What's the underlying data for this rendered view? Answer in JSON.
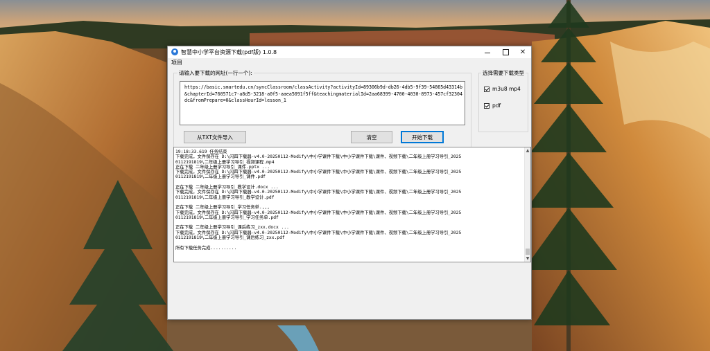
{
  "window": {
    "title": "智慧中小学平台资源下载(pdf版) 1.0.8",
    "minimize_label": "",
    "close_glyph": "✕"
  },
  "menu": {
    "items": [
      "项目"
    ]
  },
  "url_group": {
    "label": "请输入要下载的网址(一行一个):",
    "url_text": "https://basic.smartedu.cn/syncClassroom/classActivity?activityId=89306b9d-db26-4db5-9f39-54865d43314b\n&chapterId=760571c7-a8d5-3218-a0f5-aaea5091f5ff&teachingmaterialId=2aa68399-4700-4030-8973-457cf32304\ndc&fromPrepare=0&classHourId=lesson_1"
  },
  "buttons": {
    "import": "从TXT文件导入",
    "clear": "清空",
    "start": "开始下载"
  },
  "type_group": {
    "label": "选择需要下载类型",
    "options": [
      {
        "label": "m3u8 mp4",
        "checked": true
      },
      {
        "label": "pdf",
        "checked": true
      }
    ]
  },
  "log": {
    "text": "19:18:33.619 任务结束\n下载完成，文件保存在 D:\\闪四下载器-v4.0-20250112-Modify\\中小学课件下载\\中小学课件下载\\课件、视频下载\\二年级上册学习导引_2025\n0112191819\\二年级上册学习导引_视频课程.mp4\n正在下载 二年级上册学习导引_课件.pptx ...\n下载完成，文件保存在 D:\\闪四下载器-v4.0-20250112-Modify\\中小学课件下载\\中小学课件下载\\课件、视频下载\\二年级上册学习导引_2025\n0112191819\\二年级上册学习导引_课件.pdf\n\n正在下载 二年级上册学习导引_教学设计.docx ...\n下载完成，文件保存在 D:\\闪四下载器-v4.0-20250112-Modify\\中小学课件下载\\中小学课件下载\\课件、视频下载\\二年级上册学习导引_2025\n0112191819\\二年级上册学习导引_教学设计.pdf\n\n正在下载 二年级上册学习导引_学习任务单.,,,\n下载完成，文件保存在 D:\\闪四下载器-v4.0-20250112-Modify\\中小学课件下载\\中小学课件下载\\课件、视频下载\\二年级上册学习导引_2025\n0112191819\\二年级上册学习导引_学习任务单.pdf\n\n正在下载 二年级上册学习导引_课后练习_zxx.docx ...\n下载完成，文件保存在 D:\\闪四下载器-v4.0-20250112-Modify\\中小学课件下载\\中小学课件下载\\课件、视频下载\\二年级上册学习导引_2025\n0112191819\\二年级上册学习导引_课后练习_zxx.pdf\n\n所有下载任务完成.........."
  },
  "colors": {
    "accent": "#0078d7",
    "window_bg": "#f0f0f0",
    "app_icon": "#2a78d8"
  }
}
